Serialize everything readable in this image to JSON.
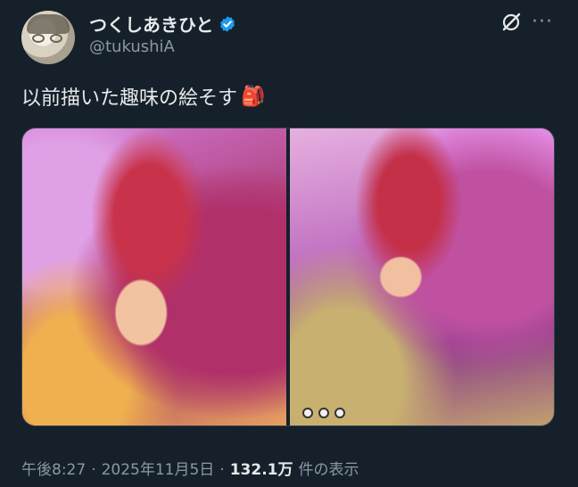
{
  "author": {
    "display_name": "つくしあきひと",
    "handle": "@tukushiA",
    "verified": true,
    "verified_color": "#1d9bf0"
  },
  "header_icons": [
    "grok-icon",
    "more-icon"
  ],
  "more_label": "···",
  "tweet": {
    "text": "以前描いた趣味の絵そす",
    "emoji": "🎒"
  },
  "media": [
    {
      "alt": "illustration-left"
    },
    {
      "alt": "illustration-right"
    }
  ],
  "meta": {
    "time": "午後8:27",
    "separator": "·",
    "date": "2025年11月5日",
    "views_count": "132.1万",
    "views_label": "件の表示"
  },
  "colors": {
    "background": "#15202b",
    "text_primary": "#e7e9ea",
    "text_secondary": "#8b98a5"
  }
}
